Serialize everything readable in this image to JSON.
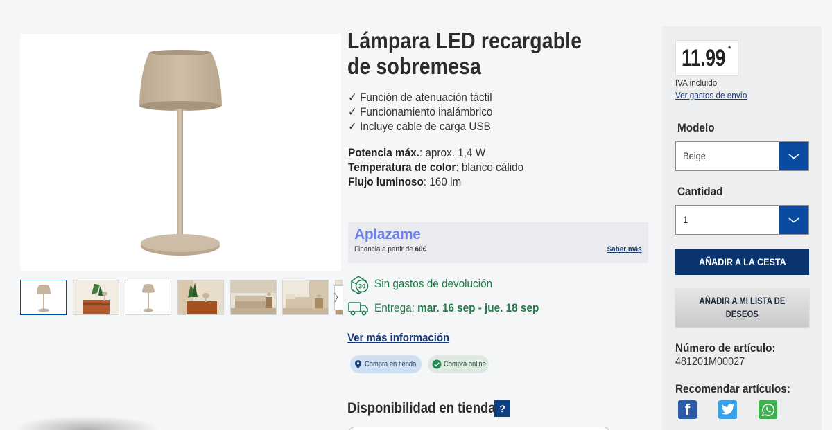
{
  "product": {
    "title": "Lámpara LED recargable de sobremesa",
    "features": [
      "✓ Función de atenuación táctil",
      "✓ Funcionamiento inalámbrico",
      "✓ Incluye cable de carga USB"
    ],
    "specs": [
      {
        "label": "Potencia máx.",
        "value": ": aprox. 1,4 W"
      },
      {
        "label": "Temperatura de color",
        "value": ": blanco cálido"
      },
      {
        "label": "Flujo luminoso",
        "value": ": 160 lm"
      }
    ]
  },
  "gallery": {
    "thumbnail_count": 7,
    "next_icon": "chevron-right-icon",
    "next_glyph": "〉"
  },
  "aplazame": {
    "logo": "Aplazame",
    "text_prefix": "Financia a partir de ",
    "amount": "60€",
    "link": "Saber más"
  },
  "returns": {
    "icon": "return-30-icon",
    "badge": "30",
    "text": "Sin gastos de devolución"
  },
  "delivery": {
    "icon": "truck-icon",
    "prefix": "Entrega: ",
    "dates": "mar. 16 sep - jue. 18 sep"
  },
  "more_info": "Ver más información",
  "badges": {
    "store": {
      "icon": "location-pin-icon",
      "label": "Compra en tienda"
    },
    "online": {
      "icon": "check-circle-icon",
      "label": "Compra online"
    }
  },
  "availability": {
    "title": "Disponibilidad en tienda",
    "help": "?"
  },
  "buy": {
    "price": "11.99",
    "price_mark": "*",
    "vat": "IVA incluido",
    "shipping_link": "Ver gastos de envío",
    "model_label": "Modelo",
    "model_value": "Beige",
    "quantity_label": "Cantidad",
    "quantity_value": "1",
    "add_to_cart": "AÑADIR A LA CESTA",
    "wishlist_line1": "AÑADIR A MI LISTA DE",
    "wishlist_line2": "DESEOS",
    "article_label": "Número de artículo:",
    "article_value": "481201M00027",
    "recommend_label": "Recomendar artículos:"
  },
  "social": [
    {
      "name": "facebook-icon",
      "glyph": "f"
    },
    {
      "name": "twitter-icon",
      "glyph": ""
    },
    {
      "name": "whatsapp-icon",
      "glyph": ""
    }
  ],
  "colors": {
    "primary_blue": "#0a3570",
    "select_arrow_blue": "#0a4aa0",
    "green_text": "#1f7a4a",
    "aplazame_purple": "#6d7fe8",
    "lamp_beige": "#c9b9a3"
  }
}
